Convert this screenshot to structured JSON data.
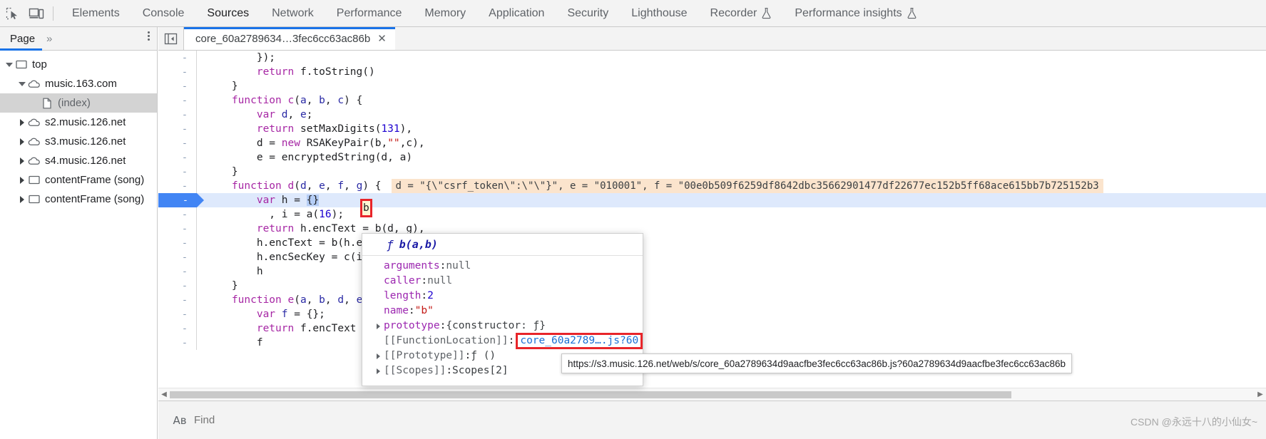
{
  "toolbar": {
    "inspect_icon": "inspect-element-icon",
    "device_icon": "device-toolbar-icon",
    "tabs": [
      {
        "label": "Elements",
        "selected": false,
        "experiment": false
      },
      {
        "label": "Console",
        "selected": false,
        "experiment": false
      },
      {
        "label": "Sources",
        "selected": true,
        "experiment": false
      },
      {
        "label": "Network",
        "selected": false,
        "experiment": false
      },
      {
        "label": "Performance",
        "selected": false,
        "experiment": false
      },
      {
        "label": "Memory",
        "selected": false,
        "experiment": false
      },
      {
        "label": "Application",
        "selected": false,
        "experiment": false
      },
      {
        "label": "Security",
        "selected": false,
        "experiment": false
      },
      {
        "label": "Lighthouse",
        "selected": false,
        "experiment": false
      },
      {
        "label": "Recorder",
        "selected": false,
        "experiment": true
      },
      {
        "label": "Performance insights",
        "selected": false,
        "experiment": true
      }
    ]
  },
  "navigator": {
    "tab_label": "Page",
    "more_tabs_label": "»",
    "tree": [
      {
        "label": "top",
        "indent": 0,
        "twisty": "down",
        "icon": "frame-icon",
        "selected": false,
        "muted": false
      },
      {
        "label": "music.163.com",
        "indent": 1,
        "twisty": "down",
        "icon": "cloud-icon",
        "selected": false,
        "muted": false
      },
      {
        "label": "(index)",
        "indent": 2,
        "twisty": "none",
        "icon": "document-icon",
        "selected": true,
        "muted": true
      },
      {
        "label": "s2.music.126.net",
        "indent": 1,
        "twisty": "right",
        "icon": "cloud-icon",
        "selected": false,
        "muted": false
      },
      {
        "label": "s3.music.126.net",
        "indent": 1,
        "twisty": "right",
        "icon": "cloud-icon",
        "selected": false,
        "muted": false
      },
      {
        "label": "s4.music.126.net",
        "indent": 1,
        "twisty": "right",
        "icon": "cloud-icon",
        "selected": false,
        "muted": false
      },
      {
        "label": "contentFrame (song)",
        "indent": 1,
        "twisty": "right",
        "icon": "frame-icon",
        "selected": false,
        "muted": false
      },
      {
        "label": "contentFrame (song)",
        "indent": 1,
        "twisty": "right",
        "icon": "frame-icon",
        "selected": false,
        "muted": false
      }
    ]
  },
  "editor": {
    "nav_toggle_icon": "show-navigator-icon",
    "tab": {
      "label": "core_60a2789634…3fec6cc63ac86b",
      "close_label": "✕"
    },
    "gutter_marker": "-",
    "inline_eval": "d = \"{\\\"csrf_token\\\":\\\"\\\"}\", e = \"010001\", f = \"00e0b509f6259df8642dbc35662901477df22677ec152b5ff68ace615bb7b725152b3",
    "highlighted_token": "b",
    "lines": [
      {
        "exec": false,
        "tokens": [
          {
            "t": "        });",
            "c": "pl"
          }
        ]
      },
      {
        "exec": false,
        "tokens": [
          {
            "t": "        ",
            "c": "pl"
          },
          {
            "t": "return",
            "c": "k"
          },
          {
            "t": " f.toString()",
            "c": "pl"
          }
        ]
      },
      {
        "exec": false,
        "tokens": [
          {
            "t": "    }",
            "c": "pl"
          }
        ]
      },
      {
        "exec": false,
        "tokens": [
          {
            "t": "    ",
            "c": "pl"
          },
          {
            "t": "function",
            "c": "k"
          },
          {
            "t": " ",
            "c": "pl"
          },
          {
            "t": "c",
            "c": "k"
          },
          {
            "t": "(",
            "c": "pl"
          },
          {
            "t": "a",
            "c": "fn"
          },
          {
            "t": ", ",
            "c": "pl"
          },
          {
            "t": "b",
            "c": "fn"
          },
          {
            "t": ", ",
            "c": "pl"
          },
          {
            "t": "c",
            "c": "fn"
          },
          {
            "t": ") {",
            "c": "pl"
          }
        ]
      },
      {
        "exec": false,
        "tokens": [
          {
            "t": "        ",
            "c": "pl"
          },
          {
            "t": "var",
            "c": "k"
          },
          {
            "t": " ",
            "c": "pl"
          },
          {
            "t": "d",
            "c": "fn"
          },
          {
            "t": ", ",
            "c": "pl"
          },
          {
            "t": "e",
            "c": "fn"
          },
          {
            "t": ";",
            "c": "pl"
          }
        ]
      },
      {
        "exec": false,
        "tokens": [
          {
            "t": "        ",
            "c": "pl"
          },
          {
            "t": "return",
            "c": "k"
          },
          {
            "t": " setMaxDigits(",
            "c": "pl"
          },
          {
            "t": "131",
            "c": "num"
          },
          {
            "t": "),",
            "c": "pl"
          }
        ]
      },
      {
        "exec": false,
        "tokens": [
          {
            "t": "        d = ",
            "c": "pl"
          },
          {
            "t": "new",
            "c": "k"
          },
          {
            "t": " RSAKeyPair(b,",
            "c": "pl"
          },
          {
            "t": "\"\"",
            "c": "str"
          },
          {
            "t": ",c),",
            "c": "pl"
          }
        ]
      },
      {
        "exec": false,
        "tokens": [
          {
            "t": "        e = encryptedString(d, a)",
            "c": "pl"
          }
        ]
      },
      {
        "exec": false,
        "tokens": [
          {
            "t": "    }",
            "c": "pl"
          }
        ]
      },
      {
        "exec": false,
        "hasEval": true,
        "tokens": [
          {
            "t": "    ",
            "c": "pl"
          },
          {
            "t": "function",
            "c": "k"
          },
          {
            "t": " ",
            "c": "pl"
          },
          {
            "t": "d",
            "c": "k"
          },
          {
            "t": "(",
            "c": "pl"
          },
          {
            "t": "d",
            "c": "fn"
          },
          {
            "t": ", ",
            "c": "pl"
          },
          {
            "t": "e",
            "c": "fn"
          },
          {
            "t": ", ",
            "c": "pl"
          },
          {
            "t": "f",
            "c": "fn"
          },
          {
            "t": ", ",
            "c": "pl"
          },
          {
            "t": "g",
            "c": "fn"
          },
          {
            "t": ") {",
            "c": "pl"
          }
        ]
      },
      {
        "exec": true,
        "tokens": [
          {
            "t": "        ",
            "c": "pl"
          },
          {
            "t": "var",
            "c": "k"
          },
          {
            "t": " h = ",
            "c": "pl"
          },
          {
            "t": "{}",
            "c": "sel-token"
          }
        ]
      },
      {
        "exec": false,
        "tokens": [
          {
            "t": "          , i = a(",
            "c": "pl"
          },
          {
            "t": "16",
            "c": "num"
          },
          {
            "t": ");",
            "c": "pl"
          }
        ]
      },
      {
        "exec": false,
        "tokens": [
          {
            "t": "        ",
            "c": "pl"
          },
          {
            "t": "return",
            "c": "k"
          },
          {
            "t": " h.encText = b(d, g),",
            "c": "pl"
          }
        ]
      },
      {
        "exec": false,
        "tokens": [
          {
            "t": "        h.encText = b(h.encText, i)",
            "c": "pl"
          }
        ]
      },
      {
        "exec": false,
        "tokens": [
          {
            "t": "        h.encSecKey = c(i, e, f),",
            "c": "pl"
          }
        ]
      },
      {
        "exec": false,
        "tokens": [
          {
            "t": "        h",
            "c": "pl"
          }
        ]
      },
      {
        "exec": false,
        "tokens": [
          {
            "t": "    }",
            "c": "pl"
          }
        ]
      },
      {
        "exec": false,
        "tokens": [
          {
            "t": "    ",
            "c": "pl"
          },
          {
            "t": "function",
            "c": "k"
          },
          {
            "t": " ",
            "c": "pl"
          },
          {
            "t": "e",
            "c": "k"
          },
          {
            "t": "(",
            "c": "pl"
          },
          {
            "t": "a",
            "c": "fn"
          },
          {
            "t": ", ",
            "c": "pl"
          },
          {
            "t": "b",
            "c": "fn"
          },
          {
            "t": ", ",
            "c": "pl"
          },
          {
            "t": "d",
            "c": "fn"
          },
          {
            "t": ", ",
            "c": "pl"
          },
          {
            "t": "e",
            "c": "fn"
          },
          {
            "t": ") {",
            "c": "pl"
          }
        ]
      },
      {
        "exec": false,
        "tokens": [
          {
            "t": "        ",
            "c": "pl"
          },
          {
            "t": "var",
            "c": "k"
          },
          {
            "t": " ",
            "c": "pl"
          },
          {
            "t": "f",
            "c": "fn"
          },
          {
            "t": " = {};",
            "c": "pl"
          }
        ]
      },
      {
        "exec": false,
        "tokens": [
          {
            "t": "        ",
            "c": "pl"
          },
          {
            "t": "return",
            "c": "k"
          },
          {
            "t": " f.encText =",
            "c": "pl"
          }
        ]
      },
      {
        "exec": false,
        "tokens": [
          {
            "t": "        f",
            "c": "pl"
          }
        ]
      }
    ]
  },
  "popover": {
    "title_glyph": "ƒ",
    "title": "b(a,b)",
    "rows": [
      {
        "key": "arguments",
        "sep": ": ",
        "value": "null",
        "vclass": "pv-null",
        "expandable": false,
        "internal": false,
        "linked": false
      },
      {
        "key": "caller",
        "sep": ": ",
        "value": "null",
        "vclass": "pv-null",
        "expandable": false,
        "internal": false,
        "linked": false
      },
      {
        "key": "length",
        "sep": ": ",
        "value": "2",
        "vclass": "pv-num",
        "expandable": false,
        "internal": false,
        "linked": false
      },
      {
        "key": "name",
        "sep": ": ",
        "value": "\"b\"",
        "vclass": "pv-str",
        "expandable": false,
        "internal": false,
        "linked": false
      },
      {
        "key": "prototype",
        "sep": ": ",
        "value": "{constructor: ƒ}",
        "vclass": "pv-obj",
        "expandable": true,
        "internal": false,
        "linked": false
      },
      {
        "key": "[[FunctionLocation]]",
        "sep": ": ",
        "value": "core_60a2789….js?60",
        "vclass": "pv-link",
        "expandable": false,
        "internal": true,
        "linked": true
      },
      {
        "key": "[[Prototype]]",
        "sep": ": ",
        "value": "ƒ ()",
        "vclass": "pv-obj",
        "expandable": true,
        "internal": true,
        "linked": false
      },
      {
        "key": "[[Scopes]]",
        "sep": ": ",
        "value": "Scopes[2]",
        "vclass": "pv-obj",
        "expandable": true,
        "internal": true,
        "linked": false
      }
    ]
  },
  "url_tooltip": {
    "text": "https://s3.music.126.net/web/s/core_60a2789634d9aacfbe3fec6cc63ac86b.js?60a2789634d9aacfbe3fec6cc63ac86b"
  },
  "find_bar": {
    "icon": "case-sensitive-icon",
    "icon_text": "Aʙ",
    "placeholder": "Find",
    "value": ""
  },
  "scrollbar": {
    "left_arrow": "◀",
    "right_arrow": "▶"
  },
  "watermark": {
    "text": "CSDN @永远十八的小仙女~"
  },
  "colors": {
    "accent": "#1a73e8",
    "exec_line_bg": "#dee9fc",
    "exec_gutter": "#4285f4",
    "highlight_border": "#e8252a",
    "inline_eval_bg": "#fbe4cd",
    "toolbar_bg": "#f3f3f3"
  }
}
